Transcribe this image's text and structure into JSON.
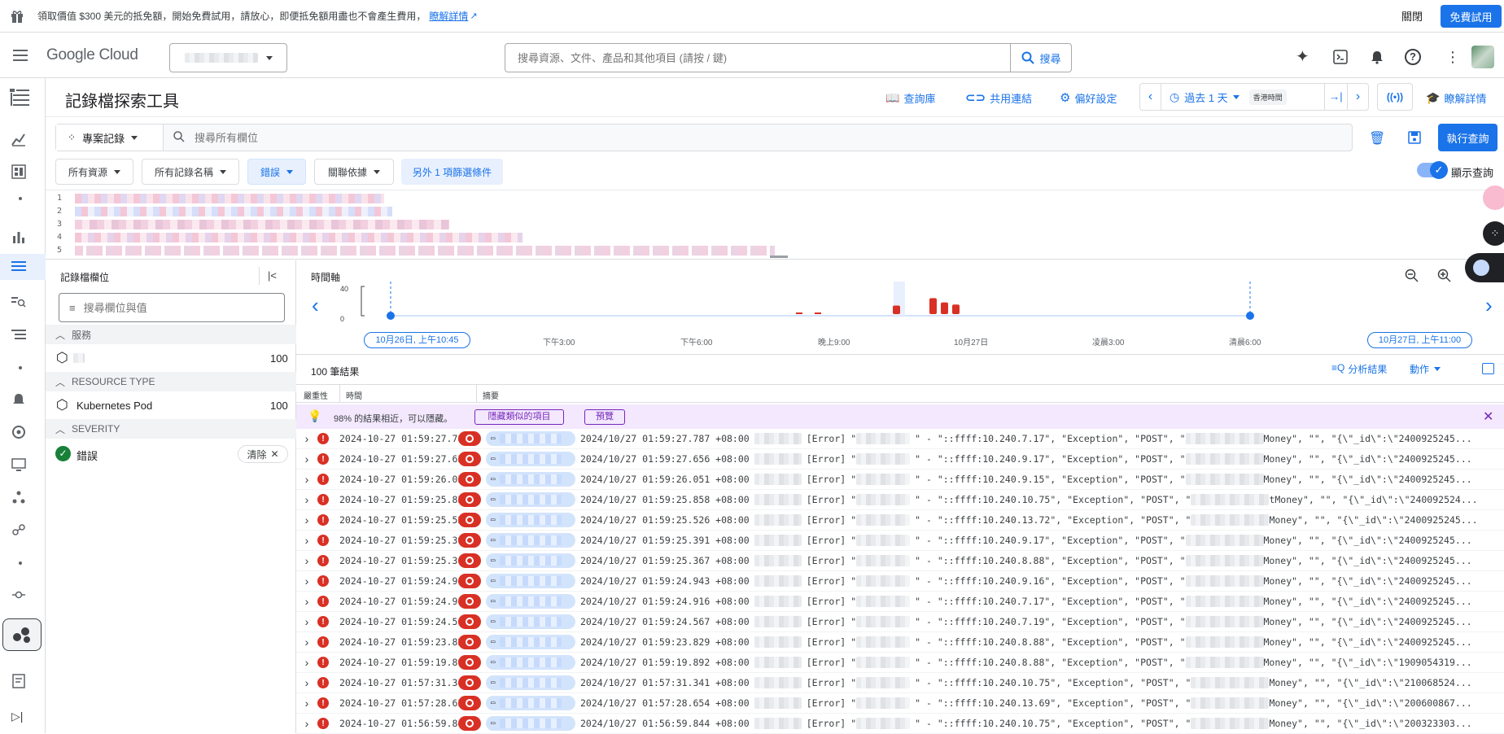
{
  "banner": {
    "message": "領取價值 $300 美元的抵免額，開始免費試用，請放心，即便抵免額用盡也不會產生費用，",
    "learn_more": "瞭解詳情",
    "dismiss": "關閉",
    "trial_button": "免費試用"
  },
  "header": {
    "brand": "Google Cloud",
    "search_placeholder": "搜尋資源、文件、產品和其他項目 (請按 / 鍵)",
    "search_button": "搜尋"
  },
  "page": {
    "title": "記錄檔探索工具",
    "actions": {
      "library": "查詢庫",
      "share_link": "共用連結",
      "preferences": "偏好設定",
      "time_range": "過去 1 天",
      "timezone": "香港時間",
      "learn": "瞭解詳情"
    }
  },
  "query": {
    "scope": "專案記錄",
    "search_placeholder": "搜尋所有欄位",
    "run_button": "執行查詢",
    "show_query_label": "顯示查詢",
    "filters": [
      "所有資源",
      "所有記錄名稱",
      "錯誤",
      "關聯依據"
    ],
    "extra_filter": "另外 1 項篩選條件",
    "line_numbers": [
      "1",
      "2",
      "3",
      "4",
      "5"
    ]
  },
  "fields_panel": {
    "title": "記錄檔欄位",
    "search_placeholder": "搜尋欄位與值",
    "sections": [
      {
        "header": "服務",
        "items": [
          {
            "label": "",
            "count": "100"
          }
        ]
      },
      {
        "header": "RESOURCE TYPE",
        "items": [
          {
            "label": "Kubernetes Pod",
            "count": "100"
          }
        ]
      },
      {
        "header": "SEVERITY",
        "items": [
          {
            "label": "錯誤",
            "clear": "清除"
          }
        ]
      }
    ]
  },
  "timeline": {
    "title": "時間軸",
    "y_max": "40",
    "y_min": "0",
    "start_chip": "10月26日, 上午10:45",
    "end_chip": "10月27日, 上午11:00",
    "ticks": [
      "下午3:00",
      "下午6:00",
      "晚上9:00",
      "10月27日",
      "凌晨3:00",
      "清晨6:00"
    ]
  },
  "chart_data": {
    "type": "bar",
    "title": "時間軸",
    "ylim": [
      0,
      40
    ],
    "categories": [
      "晚上11:30",
      "晚上11:50",
      "凌晨1:40",
      "凌晨2:40",
      "凌晨2:55",
      "凌晨3:10"
    ],
    "values": [
      1,
      1,
      8,
      15,
      11,
      9
    ],
    "color": "#d93025"
  },
  "results": {
    "count_label": "100 筆結果",
    "analyze": "分析結果",
    "actions": "動作",
    "columns": [
      "嚴重性",
      "時間",
      "摘要"
    ],
    "hint": "98% 的結果相近，可以隱藏。",
    "hide_similar": "隱藏類似的項目",
    "preview": "預覽",
    "rows": [
      {
        "time": "2024-10-27 01:59:27.787",
        "text": "2024/10/27 01:59:27.787 +08:00",
        "ip": "::ffff:10.240.7.17",
        "tail": "Money\", \"\", \"{\\\"_id\\\":\\\"2400925245..."
      },
      {
        "time": "2024-10-27 01:59:27.656",
        "text": "2024/10/27 01:59:27.656 +08:00",
        "ip": "::ffff:10.240.9.17",
        "tail": "Money\", \"\", \"{\\\"_id\\\":\\\"2400925245..."
      },
      {
        "time": "2024-10-27 01:59:26.051",
        "text": "2024/10/27 01:59:26.051 +08:00",
        "ip": "::ffff:10.240.9.15",
        "tail": "Money\", \"\", \"{\\\"_id\\\":\\\"2400925245..."
      },
      {
        "time": "2024-10-27 01:59:25.858",
        "text": "2024/10/27 01:59:25.858 +08:00",
        "ip": "::ffff:10.240.10.75",
        "tail": "tMoney\", \"\", \"{\\\"_id\\\":\\\"240092524..."
      },
      {
        "time": "2024-10-27 01:59:25.526",
        "text": "2024/10/27 01:59:25.526 +08:00",
        "ip": "::ffff:10.240.13.72",
        "tail": "Money\", \"\", \"{\\\"_id\\\":\\\"2400925245..."
      },
      {
        "time": "2024-10-27 01:59:25.391",
        "text": "2024/10/27 01:59:25.391 +08:00",
        "ip": "::ffff:10.240.9.17",
        "tail": "Money\", \"\", \"{\\\"_id\\\":\\\"2400925245..."
      },
      {
        "time": "2024-10-27 01:59:25.367",
        "text": "2024/10/27 01:59:25.367 +08:00",
        "ip": "::ffff:10.240.8.88",
        "tail": "Money\", \"\", \"{\\\"_id\\\":\\\"2400925245..."
      },
      {
        "time": "2024-10-27 01:59:24.943",
        "text": "2024/10/27 01:59:24.943 +08:00",
        "ip": "::ffff:10.240.9.16",
        "tail": "Money\", \"\", \"{\\\"_id\\\":\\\"2400925245..."
      },
      {
        "time": "2024-10-27 01:59:24.916",
        "text": "2024/10/27 01:59:24.916 +08:00",
        "ip": "::ffff:10.240.7.17",
        "tail": "Money\", \"\", \"{\\\"_id\\\":\\\"2400925245..."
      },
      {
        "time": "2024-10-27 01:59:24.567",
        "text": "2024/10/27 01:59:24.567 +08:00",
        "ip": "::ffff:10.240.7.19",
        "tail": "Money\", \"\", \"{\\\"_id\\\":\\\"2400925245..."
      },
      {
        "time": "2024-10-27 01:59:23.829",
        "text": "2024/10/27 01:59:23.829 +08:00",
        "ip": "::ffff:10.240.8.88",
        "tail": "Money\", \"\", \"{\\\"_id\\\":\\\"2400925245..."
      },
      {
        "time": "2024-10-27 01:59:19.892",
        "text": "2024/10/27 01:59:19.892 +08:00",
        "ip": "::ffff:10.240.8.88",
        "tail": "Money\", \"\", \"{\\\"_id\\\":\\\"1909054319..."
      },
      {
        "time": "2024-10-27 01:57:31.341",
        "text": "2024/10/27 01:57:31.341 +08:00",
        "ip": "::ffff:10.240.10.75",
        "tail": "Money\", \"\", \"{\\\"_id\\\":\\\"210068524..."
      },
      {
        "time": "2024-10-27 01:57:28.654",
        "text": "2024/10/27 01:57:28.654 +08:00",
        "ip": "::ffff:10.240.13.69",
        "tail": "Money\", \"\", \"{\\\"_id\\\":\\\"200600867..."
      },
      {
        "time": "2024-10-27 01:56:59.844",
        "text": "2024/10/27 01:56:59.844 +08:00",
        "ip": "::ffff:10.240.10.75",
        "tail": "Money\", \"\", \"{\\\"_id\\\":\\\"200323303..."
      }
    ],
    "level": "[Error]",
    "exception": "Exception",
    "method": "POST"
  },
  "colors": {
    "accent": "#1a73e8",
    "error": "#d93025",
    "hint_bg": "#f3e8fd"
  }
}
